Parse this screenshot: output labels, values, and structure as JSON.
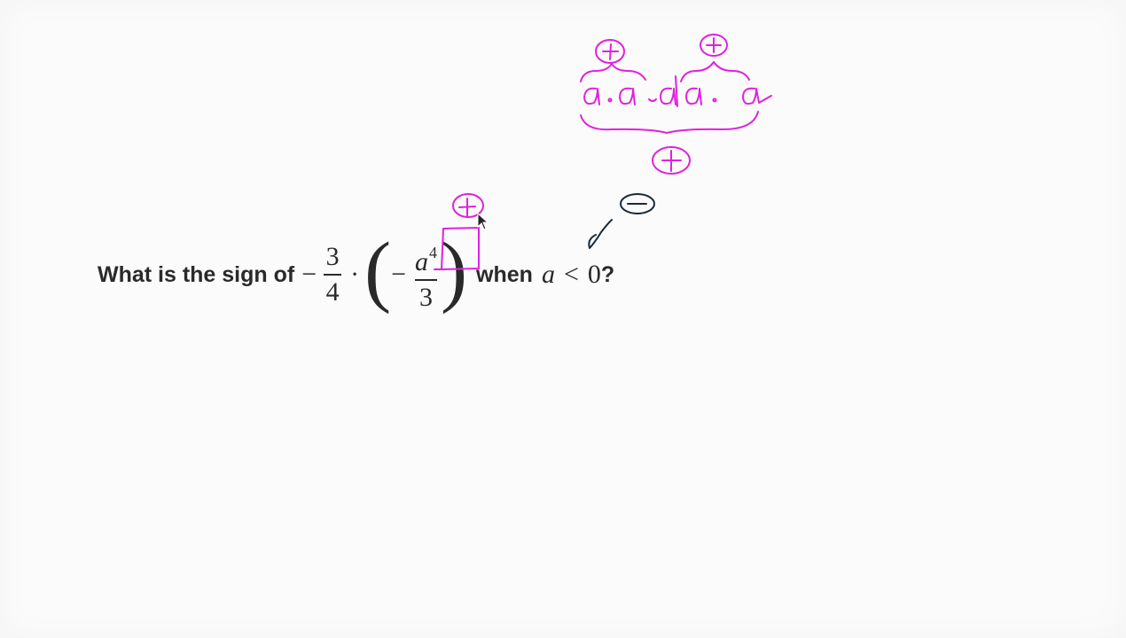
{
  "question": {
    "prefix": "What is the sign of",
    "minus1": "−",
    "frac1": {
      "num": "3",
      "den": "4"
    },
    "cdot": "·",
    "paren_open": "(",
    "minus2": "−",
    "frac2": {
      "num_base": "a",
      "num_exp": "4",
      "den": "3"
    },
    "paren_close": ")",
    "when": "when",
    "cond_var": "a",
    "cond_op": "<",
    "cond_val": "0",
    "qmark": "?"
  },
  "annotations": {
    "expansion": "a·a·a·a",
    "ink_color": "#e020e0",
    "pen_color": "#1a2a3a"
  }
}
